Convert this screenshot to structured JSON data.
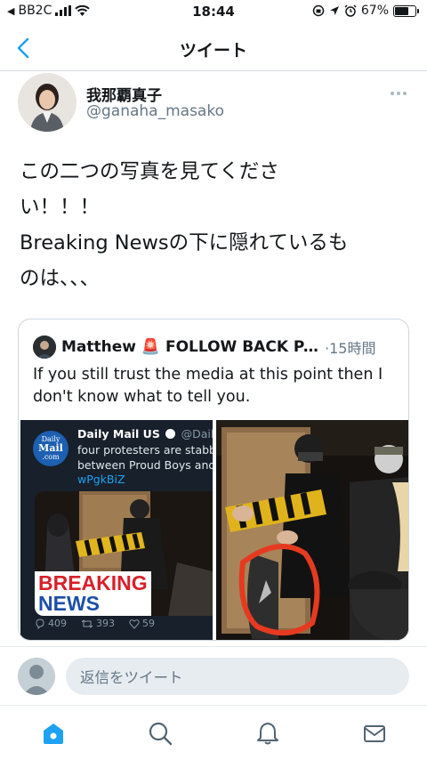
{
  "status": {
    "carrier": "BB2C",
    "time": "18:44",
    "battery": "67%",
    "battery_level": 0.67
  },
  "nav": {
    "title": "ツイート"
  },
  "tweet": {
    "display_name": "我那覇真子",
    "handle": "@ganaha_masako",
    "text": "この二つの写真を見てくださ\nい！！！\nBreaking Newsの下に隠れているも\nのは、、、"
  },
  "quote": {
    "name": "Matthew 🚨 FOLLOW BACK PA...",
    "time": "·15時間",
    "text": "If you still trust the media at this point then I don't know what to tell you.",
    "inner": {
      "account_name": "Daily Mail US",
      "account_handle": "@DailyMa",
      "text": "four protesters are stabbe\nbetween Proud Boys and B",
      "link": "wPgkBiZ",
      "logo_top": "Daily",
      "logo_main": "Mail",
      "logo_bottom": ".com",
      "breaking_line1": "BREAKING",
      "breaking_line2": "NEWS",
      "reply_count": "409",
      "retweet_count": "393",
      "like_count": "59"
    }
  },
  "reply": {
    "placeholder": "返信をツイート"
  },
  "colors": {
    "accent": "#1da1f2",
    "text": "#14171a",
    "secondary": "#657786",
    "breaking_red": "#d8202a",
    "breaking_blue": "#1d4fa8"
  }
}
